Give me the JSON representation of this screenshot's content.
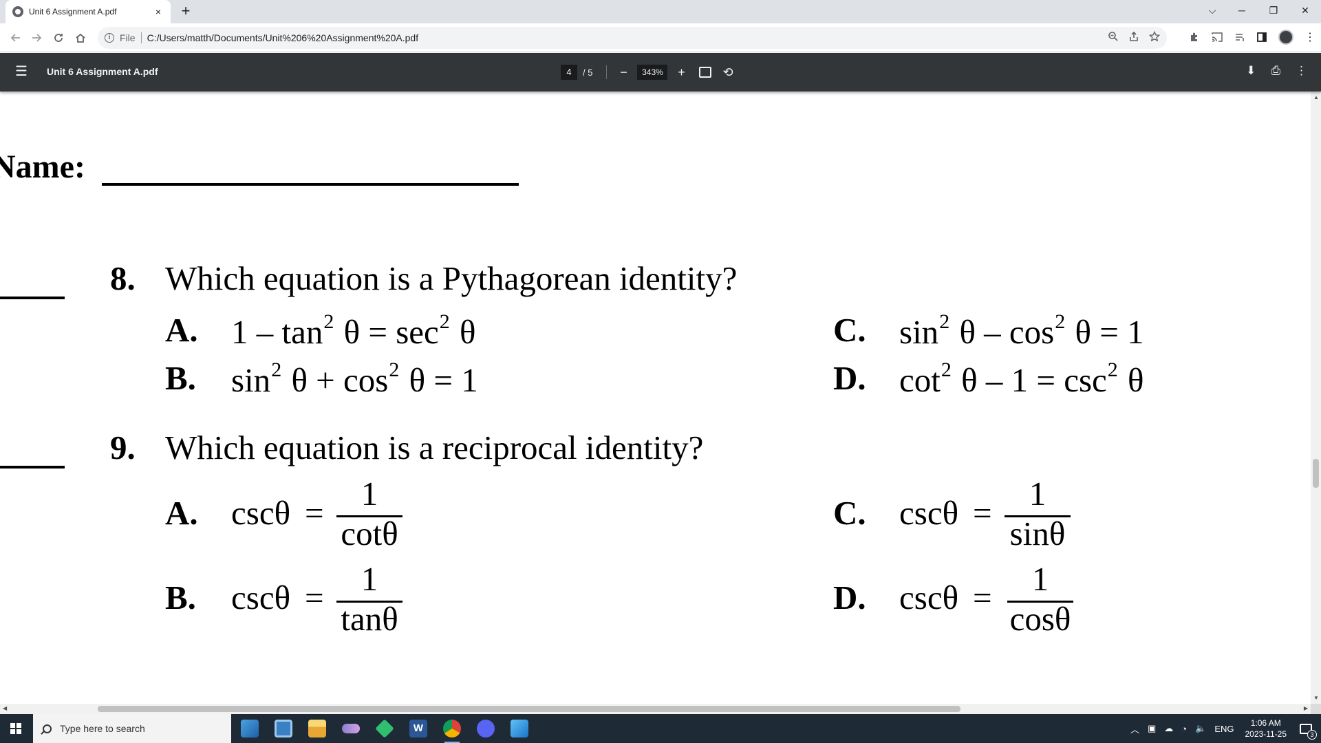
{
  "browser": {
    "tab_title": "Unit 6 Assignment A.pdf",
    "tab_close": "×",
    "new_tab": "+",
    "address_scheme": "File",
    "address_url": "C:/Users/matth/Documents/Unit%206%20Assignment%20A.pdf",
    "window_controls": {
      "tab_search": "⌵",
      "minimize": "─",
      "restore": "❐",
      "close": "✕"
    }
  },
  "pdf_toolbar": {
    "menu": "☰",
    "title": "Unit 6 Assignment A.pdf",
    "page_current": "4",
    "page_total": "/  5",
    "zoom_out": "−",
    "zoom": "343%",
    "zoom_in": "+",
    "rotate": "⟲",
    "download": "⬇",
    "print": "⎙",
    "more": "⋮"
  },
  "document": {
    "name_label": "Name:",
    "questions": [
      {
        "number": "8.",
        "text": "Which equation is a Pythagorean identity?",
        "options": [
          {
            "letter": "A.",
            "expr": [
              "1 – tan",
              "2",
              " θ = sec",
              "2",
              " θ"
            ]
          },
          {
            "letter": "B.",
            "expr": [
              "sin",
              "2",
              " θ + cos",
              "2",
              " θ = 1"
            ]
          },
          {
            "letter": "C.",
            "expr": [
              "sin",
              "2",
              " θ – cos",
              "2",
              " θ = 1"
            ]
          },
          {
            "letter": "D.",
            "expr": [
              "cot",
              "2",
              " θ – 1 = csc",
              "2",
              " θ"
            ]
          }
        ]
      },
      {
        "number": "9.",
        "text": "Which equation is a reciprocal identity?",
        "options": [
          {
            "letter": "A.",
            "lhs": "cscθ",
            "eq": "=",
            "num": "1",
            "den": "cotθ"
          },
          {
            "letter": "B.",
            "lhs": "cscθ",
            "eq": "=",
            "num": "1",
            "den": "tanθ"
          },
          {
            "letter": "C.",
            "lhs": "cscθ",
            "eq": "=",
            "num": "1",
            "den": "sinθ"
          },
          {
            "letter": "D.",
            "lhs": "cscθ",
            "eq": "=",
            "num": "1",
            "den": "cosθ"
          }
        ]
      }
    ]
  },
  "taskbar": {
    "search_placeholder": "Type here to search",
    "tray_language": "ENG",
    "clock_time": "1:06 AM",
    "clock_date": "2023-11-25",
    "notification_count": "3",
    "icons": [
      "pen-app-icon",
      "desktop-app-icon",
      "file-explorer-icon",
      "game-launcher-icon",
      "media-app-icon",
      "word-icon",
      "chrome-icon",
      "discord-icon",
      "paint-icon"
    ]
  }
}
